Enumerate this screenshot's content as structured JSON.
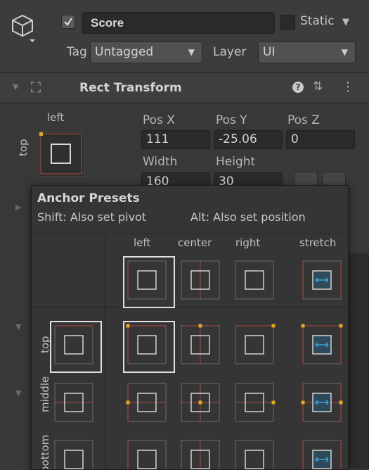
{
  "header": {
    "object_name": "Score",
    "active": true,
    "static_label": "Static",
    "tag_label": "Tag",
    "tag_value": "Untagged",
    "layer_label": "Layer",
    "layer_value": "UI"
  },
  "rect_transform": {
    "title": "Rect Transform",
    "anchor_h_label": "left",
    "anchor_v_label": "top",
    "fields": {
      "pos_x_label": "Pos X",
      "pos_x": "111",
      "pos_y_label": "Pos Y",
      "pos_y": "-25.06",
      "pos_z_label": "Pos Z",
      "pos_z": "0",
      "width_label": "Width",
      "width": "160",
      "height_label": "Height",
      "height": "30"
    }
  },
  "anchor_presets": {
    "title": "Anchor Presets",
    "hint_pivot": "Shift: Also set pivot",
    "hint_position": "Alt: Also set position",
    "columns": [
      "left",
      "center",
      "right",
      "stretch"
    ],
    "rows": [
      "top",
      "middle",
      "bottom"
    ],
    "selected": {
      "column": "left",
      "row": "top"
    }
  },
  "colors": {
    "anchor_line": "#b04a44",
    "anchor_marker": "#e0a820",
    "stretch_arrow": "#3fa8d8",
    "selection": "#e0e0e0"
  },
  "icons": [
    "cube-icon",
    "help-icon",
    "preset-icon",
    "more-icon",
    "check-icon",
    "dropdown-arrow-icon"
  ]
}
